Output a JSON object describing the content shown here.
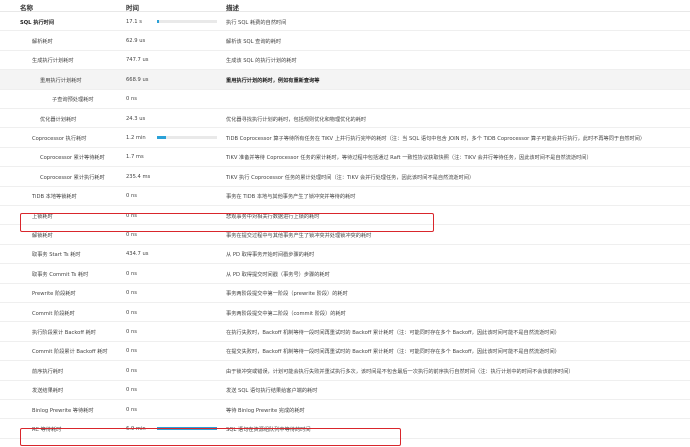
{
  "header": {
    "name": "名称",
    "time": "时间",
    "desc": "描述"
  },
  "colors": {
    "bar": "#2aa1d7",
    "highlight_box": "#d9262c"
  },
  "rows": [
    {
      "name": "SQL 执行时间",
      "time": "17.1 s",
      "desc": "执行 SQL 耗费的自然时间",
      "bar": 0.03,
      "bold": true
    },
    {
      "name": "解析耗时",
      "time": "62.9 us",
      "desc": "解析该 SQL 查询的耗时"
    },
    {
      "name": "生成执行计划耗时",
      "time": "747.7 us",
      "desc": "生成该 SQL 的执行计划的耗时"
    },
    {
      "name": "重用执行计划耗时",
      "time": "668.9 us",
      "desc": "重用执行计划的耗时，例如有重新查询等",
      "highlight": true,
      "bold_desc": true
    },
    {
      "name": "子查询预处理耗时",
      "time": "0 ns",
      "desc": ""
    },
    {
      "name": "优化器计划耗时",
      "time": "24.3 us",
      "desc": "优化器寻找执行计划的耗时，包括规则优化和物理优化的耗时"
    },
    {
      "name": "Coprocessor 执行耗时",
      "time": "1.2 min",
      "desc": "TiDB Coprocessor 算子等待所有任务在 TiKV 上并行执行完毕的耗时（注：当 SQL 语句中包含 JOIN 时，多个 TiDB Coprocessor 算子可能会并行执行，此时不再等同于自然时间）",
      "bar": 0.15
    },
    {
      "name": "Coprocessor 累计等待耗时",
      "time": "1.7 ms",
      "desc": "TiKV 准备并等待 Coprocessor 任务的累计耗时，等待过程中包括通过 Raft 一致性协议获取快照（注：TiKV 会并行等待任务，因此该时间不是自然流逝时间）"
    },
    {
      "name": "Coprocessor 累计执行耗时",
      "time": "235.4 ms",
      "desc": "TiKV 执行 Coprocessor 任务的累计处理时间（注：TiKV 会并行处理任务，因此该时间不是自然流逝时间）"
    },
    {
      "name": "TiDB 本地等锁耗时",
      "time": "0 ns",
      "desc": "事务在 TiDB 本地与其他事务产生了锁冲突并等待的耗时"
    },
    {
      "name": "上锁耗时",
      "time": "0 ns",
      "desc": "悲观事务中对相关行数据进行上锁的耗时"
    },
    {
      "name": "解锁耗时",
      "time": "0 ns",
      "desc": "事务在提交过程中与其他事务产生了锁冲突并处理锁冲突的耗时"
    },
    {
      "name": "取事务 Start Ts 耗时",
      "time": "434.7 us",
      "desc": "从 PD 取得事务开始时间戳步骤的耗时"
    },
    {
      "name": "取事务 Commit Ts 耗时",
      "time": "0 ns",
      "desc": "从 PD 取得提交时间戳（事务号）步骤的耗时"
    },
    {
      "name": "Prewrite 阶段耗时",
      "time": "0 ns",
      "desc": "事务两阶段提交中第一阶段（prewrite 阶段）的耗时"
    },
    {
      "name": "Commit 阶段耗时",
      "time": "0 ns",
      "desc": "事务两阶段提交中第二阶段（commit 阶段）的耗时"
    },
    {
      "name": "执行阶段累计 Backoff 耗时",
      "time": "0 ns",
      "desc": "在执行失败时，Backoff 机制等待一段时间再重试时的 Backoff 累计耗时（注：可能同时存在多个 Backoff，因此该时间可能不是自然流逝时间）"
    },
    {
      "name": "Commit 阶段累计 Backoff 耗时",
      "time": "0 ns",
      "desc": "在提交失败时，Backoff 机制等待一段时间再重试时的 Backoff 累计耗时（注：可能同时存在多个 Backoff，因此该时间可能不是自然流逝时间）"
    },
    {
      "name": "前序执行耗时",
      "time": "0 ns",
      "desc": "由于锁冲突或错误，计划可能会执行失败并重试执行多次，该时间是不包含最后一次执行的前序执行自然时间（注：执行计划中的时间不会该前序时间）"
    },
    {
      "name": "发送结果耗时",
      "time": "0 ns",
      "desc": "发送 SQL 语句执行结果给客户端的耗时"
    },
    {
      "name": "Binlog Prewrite 等待耗时",
      "time": "0 ns",
      "desc": "等待 Binlog Prewrite 完成的耗时"
    },
    {
      "name": "RC 等待耗时",
      "time": "6.9 min",
      "desc": "SQL 语句在资源组队列中等待的时间",
      "bar": 1.0
    }
  ]
}
